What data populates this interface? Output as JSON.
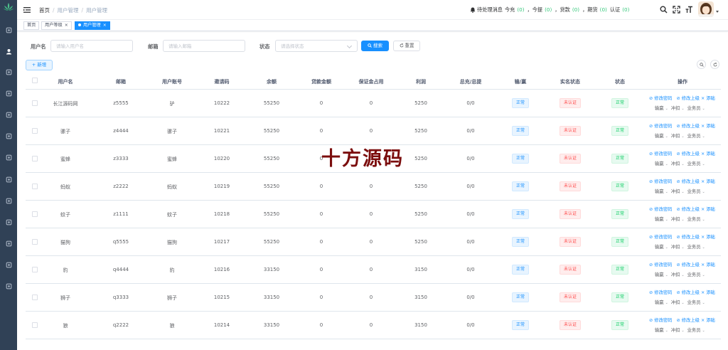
{
  "header": {
    "breadcrumb": [
      "首页",
      "用户管理",
      "用户管理"
    ],
    "notice": {
      "label": "待处理消息",
      "items": [
        {
          "label": "今充",
          "count": "(0)"
        },
        {
          "label": "，今提",
          "count": "(0)"
        },
        {
          "label": "，贷款",
          "count": "(0)"
        },
        {
          "label": "，期货",
          "count": "(0)"
        },
        {
          "label": "认证",
          "count": "(0)"
        }
      ]
    },
    "icons": [
      "search-icon",
      "fullscreen-icon",
      "font-size-icon"
    ]
  },
  "tags": [
    {
      "label": "首页"
    },
    {
      "label": "用户等级",
      "close": "×"
    },
    {
      "label": "用户管理",
      "close": "×",
      "active": true
    }
  ],
  "search": {
    "username_label": "用户名",
    "username_placeholder": "请输入用户名",
    "email_label": "邮箱",
    "email_placeholder": "请输入邮箱",
    "status_label": "状态",
    "status_placeholder": "请选择状态",
    "search_button": "搜索",
    "reset_button": "重置"
  },
  "toolbar": {
    "add_button": "+ 新增"
  },
  "table": {
    "columns": [
      "用户名",
      "邮箱",
      "用户账号",
      "邀请码",
      "余额",
      "贷款金额",
      "保证金占用",
      "利润",
      "总充/总提",
      "输/赢",
      "实名状态",
      "状态",
      "操作"
    ],
    "ops": {
      "edit_password": "⊘ 修改密码",
      "edit_parent": "⊘ 修改上级",
      "add": "× 添础",
      "dropdowns": [
        "输赢",
        "冲扣",
        "业务员"
      ]
    },
    "rows": [
      {
        "username": "长江源码网",
        "email": "z5555",
        "account": "驴",
        "invite": "10222",
        "balance": "55250",
        "loan": "0",
        "deposit": "0",
        "profit": "5250",
        "total": "0/0",
        "winlose": "正常",
        "realname": "未认证",
        "status": "正常"
      },
      {
        "username": "骡子",
        "email": "z4444",
        "account": "骡子",
        "invite": "10221",
        "balance": "55250",
        "loan": "0",
        "deposit": "0",
        "profit": "5250",
        "total": "0/0",
        "winlose": "正常",
        "realname": "未认证",
        "status": "正常"
      },
      {
        "username": "蜜蜂",
        "email": "z3333",
        "account": "蜜蜂",
        "invite": "10220",
        "balance": "55250",
        "loan": "0",
        "deposit": "0",
        "profit": "5250",
        "total": "0/0",
        "winlose": "正常",
        "realname": "未认证",
        "status": "正常"
      },
      {
        "username": "蚂蚁",
        "email": "z2222",
        "account": "蚂蚁",
        "invite": "10219",
        "balance": "55250",
        "loan": "0",
        "deposit": "0",
        "profit": "5250",
        "total": "0/0",
        "winlose": "正常",
        "realname": "未认证",
        "status": "正常"
      },
      {
        "username": "蚊子",
        "email": "z1111",
        "account": "蚊子",
        "invite": "10218",
        "balance": "55250",
        "loan": "0",
        "deposit": "0",
        "profit": "5250",
        "total": "0/0",
        "winlose": "正常",
        "realname": "未认证",
        "status": "正常"
      },
      {
        "username": "猫狗",
        "email": "q5555",
        "account": "猫狗",
        "invite": "10217",
        "balance": "55250",
        "loan": "0",
        "deposit": "0",
        "profit": "5250",
        "total": "0/0",
        "winlose": "正常",
        "realname": "未认证",
        "status": "正常"
      },
      {
        "username": "豹",
        "email": "q4444",
        "account": "豹",
        "invite": "10216",
        "balance": "33150",
        "loan": "0",
        "deposit": "0",
        "profit": "3150",
        "total": "0/0",
        "winlose": "正常",
        "realname": "未认证",
        "status": "正常"
      },
      {
        "username": "狮子",
        "email": "q3333",
        "account": "狮子",
        "invite": "10215",
        "balance": "33150",
        "loan": "0",
        "deposit": "0",
        "profit": "3150",
        "total": "0/0",
        "winlose": "正常",
        "realname": "未认证",
        "status": "正常"
      },
      {
        "username": "狼",
        "email": "q2222",
        "account": "狼",
        "invite": "10214",
        "balance": "33150",
        "loan": "0",
        "deposit": "0",
        "profit": "3150",
        "total": "0/0",
        "winlose": "正常",
        "realname": "未认证",
        "status": "正常"
      }
    ]
  },
  "watermark": "十方源码",
  "colors": {
    "primary": "#1890ff",
    "sidebar": "#304156",
    "success": "#13ce66",
    "danger": "#ff4949",
    "notice_count": "#34c77a"
  }
}
